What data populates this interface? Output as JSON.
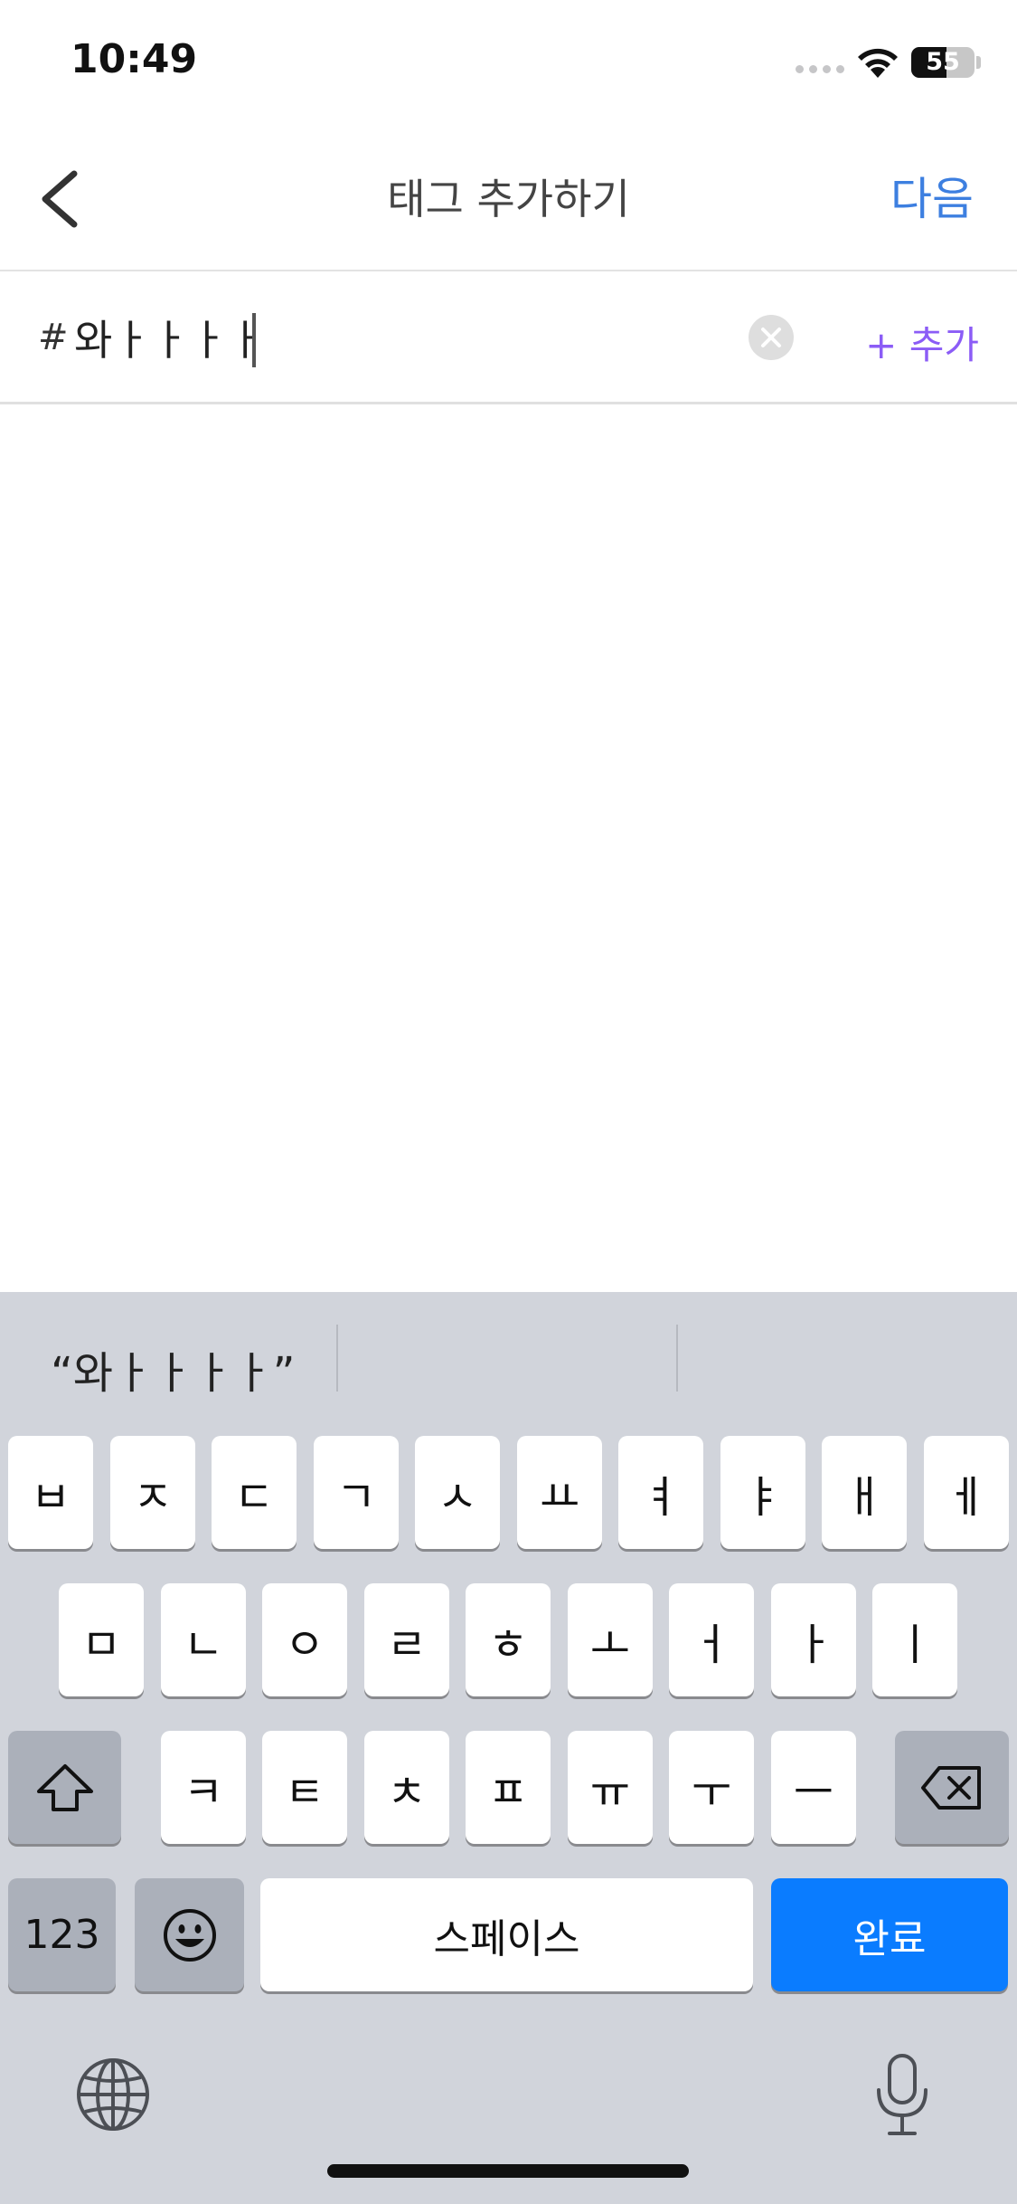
{
  "status_bar": {
    "time": "10:49",
    "battery_level": "55",
    "battery_fraction": 0.55
  },
  "nav": {
    "title": "태그 추가하기",
    "next_label": "다음",
    "back_icon": "chevron-left-icon"
  },
  "tag_input": {
    "hash": "#",
    "value": "와ㅏㅏㅏㅏ",
    "add_label": "+ 추가",
    "accent_color": "#8b5cf6"
  },
  "keyboard": {
    "suggestion": "“와ㅏㅏㅏㅏ”",
    "row1": [
      "ㅂ",
      "ㅈ",
      "ㄷ",
      "ㄱ",
      "ㅅ",
      "ㅛ",
      "ㅕ",
      "ㅑ",
      "ㅐ",
      "ㅔ"
    ],
    "row2": [
      "ㅁ",
      "ㄴ",
      "ㅇ",
      "ㄹ",
      "ㅎ",
      "ㅗ",
      "ㅓ",
      "ㅏ",
      "ㅣ"
    ],
    "row3": [
      "ㅋ",
      "ㅌ",
      "ㅊ",
      "ㅍ",
      "ㅠ",
      "ㅜ",
      "ㅡ"
    ],
    "numbers_label": "123",
    "space_label": "스페이스",
    "done_label": "완료",
    "done_color": "#0a7cff"
  }
}
